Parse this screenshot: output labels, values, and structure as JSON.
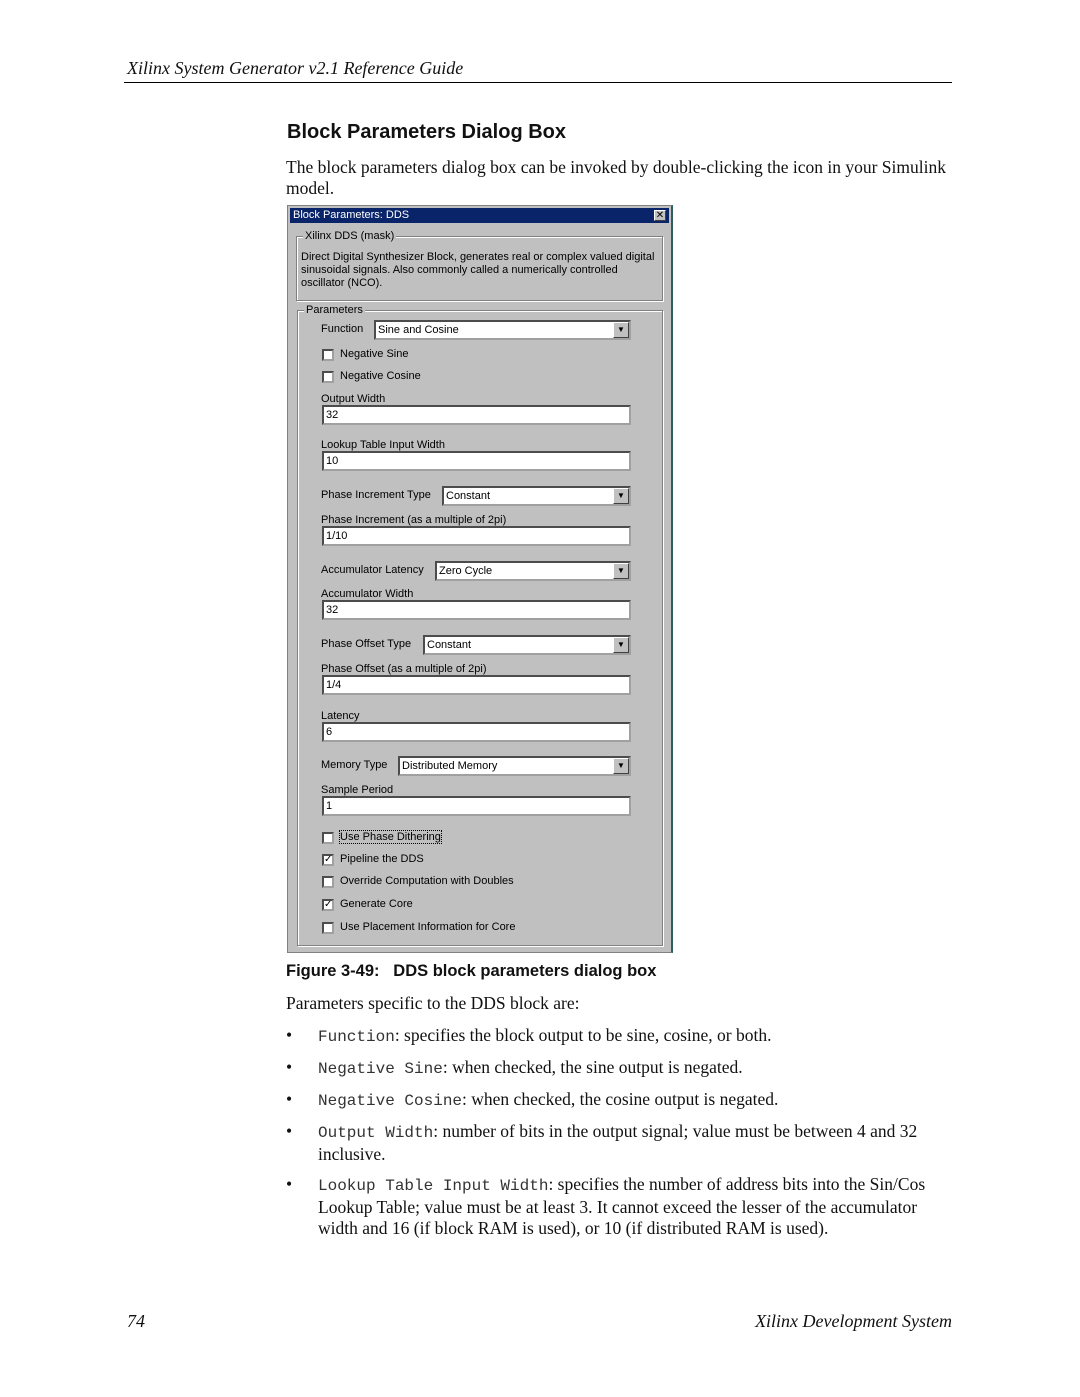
{
  "page": {
    "header": "Xilinx System Generator v2.1 Reference Guide",
    "heading": "Block Parameters Dialog Box",
    "intro": "The block parameters dialog box can be invoked by double-clicking the icon in your Simulink model.",
    "caption": "Figure 3-49:   DDS block parameters dialog box",
    "params_intro": "Parameters specific to the DDS block are:",
    "bullets": [
      {
        "code": "Function",
        "text": ": specifies the block output to be sine, cosine, or both."
      },
      {
        "code": "Negative Sine",
        "text": ": when checked, the sine output is negated."
      },
      {
        "code": "Negative Cosine",
        "text": ": when checked, the cosine output is negated."
      },
      {
        "code": "Output Width",
        "text": ": number of bits in the output signal; value must be between 4 and 32 inclusive."
      },
      {
        "code": "Lookup Table Input Width",
        "text": ": specifies the number of address bits into the Sin/Cos Lookup Table; value must be at least 3. It cannot exceed the lesser of the accumulator width and 16 (if block RAM is used), or 10 (if distributed RAM is used)."
      }
    ],
    "page_number": "74",
    "footer": "Xilinx Development System"
  },
  "dialog": {
    "title": "Block Parameters: DDS",
    "close_icon": "close-icon",
    "mask_label": "Xilinx DDS (mask)",
    "mask_text": "Direct Digital Synthesizer Block, generates real or complex valued digital sinusoidal signals.  Also commonly called a numerically controlled oscillator (NCO).",
    "params_label": "Parameters",
    "function_label": "Function",
    "function_value": "Sine and Cosine",
    "negative_sine": {
      "label": "Negative Sine",
      "checked": false
    },
    "negative_cosine": {
      "label": "Negative Cosine",
      "checked": false
    },
    "output_width_label": "Output Width",
    "output_width": "32",
    "lut_label": "Lookup Table Input Width",
    "lut_value": "10",
    "phase_inc_type_label": "Phase Increment Type",
    "phase_inc_type": "Constant",
    "phase_inc_label": "Phase Increment  (as a multiple of 2pi)",
    "phase_inc": "1/10",
    "acc_latency_label": "Accumulator Latency",
    "acc_latency": "Zero Cycle",
    "acc_width_label": "Accumulator Width",
    "acc_width": "32",
    "phase_off_type_label": "Phase Offset Type",
    "phase_off_type": "Constant",
    "phase_off_label": "Phase Offset  (as a multiple of 2pi)",
    "phase_off": "1/4",
    "latency_label": "Latency",
    "latency": "6",
    "memory_type_label": "Memory Type",
    "memory_type": "Distributed Memory",
    "sample_period_label": "Sample Period",
    "sample_period": "1",
    "checkboxes": [
      {
        "label": "Use Phase Dithering",
        "checked": false
      },
      {
        "label": "Pipeline the DDS",
        "checked": true
      },
      {
        "label": "Override Computation with Doubles",
        "checked": false
      },
      {
        "label": "Generate Core",
        "checked": true
      },
      {
        "label": "Use Placement Information for Core",
        "checked": false
      }
    ]
  }
}
